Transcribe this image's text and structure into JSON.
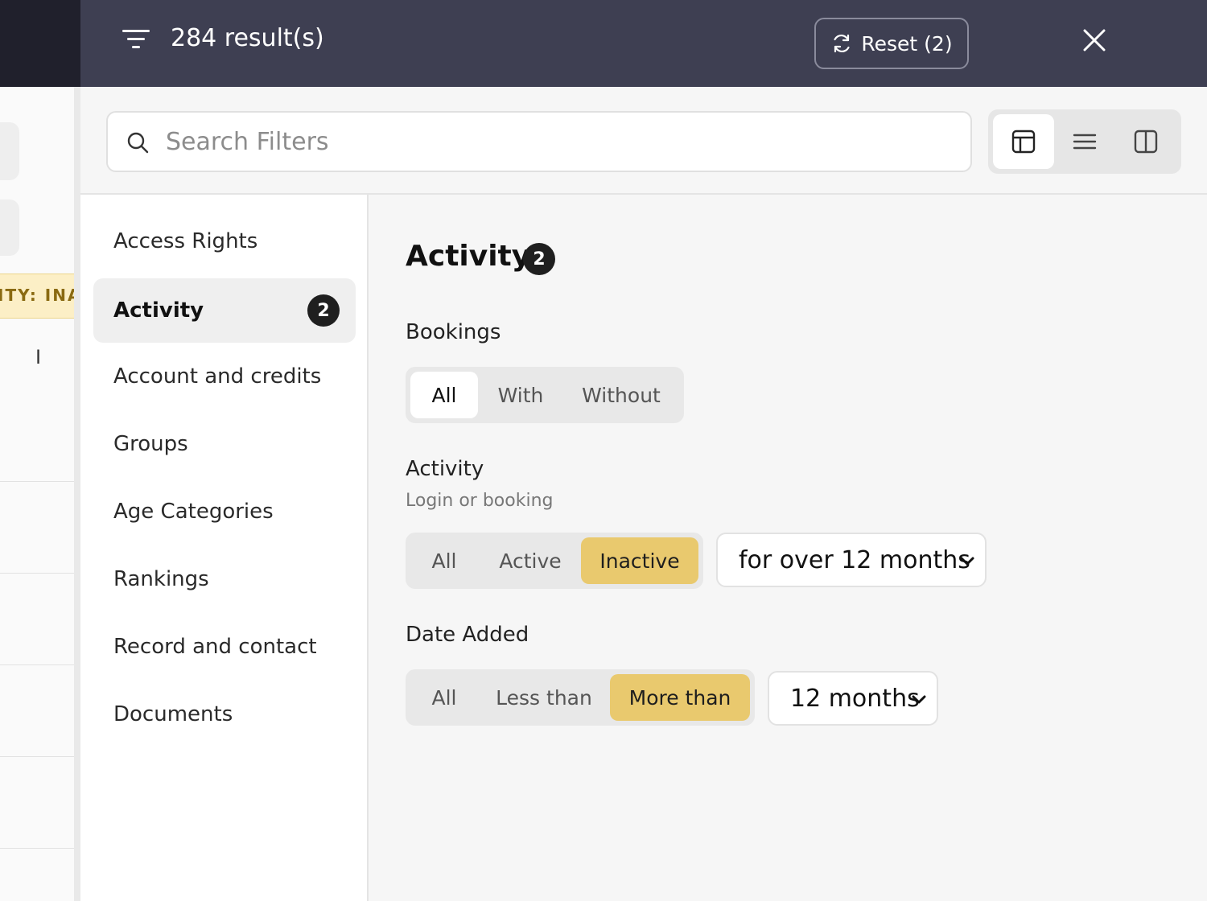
{
  "background": {
    "chip_text": "ITY: INAC",
    "cursor_glyph": "I"
  },
  "header": {
    "results_text": "284 result(s)",
    "reset_label": "Reset (2)"
  },
  "search": {
    "placeholder": "Search Filters",
    "value": ""
  },
  "view_modes": [
    "layout-panel-icon",
    "list-icon",
    "columns-icon"
  ],
  "sidebar": {
    "items": [
      {
        "label": "Access Rights"
      },
      {
        "label": "Activity",
        "badge": "2"
      },
      {
        "label": "Account and credits"
      },
      {
        "label": "Groups"
      },
      {
        "label": "Age Categories"
      },
      {
        "label": "Rankings"
      },
      {
        "label": "Record and contact"
      },
      {
        "label": "Documents"
      }
    ]
  },
  "content": {
    "title": "Activity",
    "badge": "2",
    "bookings": {
      "label": "Bookings",
      "options": [
        "All",
        "With",
        "Without"
      ],
      "selected": "All"
    },
    "activity": {
      "label": "Activity",
      "sublabel": "Login or booking",
      "options": [
        "All",
        "Active",
        "Inactive"
      ],
      "selected": "Inactive",
      "period": "for over 12 months"
    },
    "date_added": {
      "label": "Date Added",
      "options": [
        "All",
        "Less than",
        "More than"
      ],
      "selected": "More than",
      "period": "12 months"
    }
  },
  "colors": {
    "header_bg": "#3e3f52",
    "accent_yellow": "#e9c96e",
    "badge_dark": "#1f1f1f"
  }
}
